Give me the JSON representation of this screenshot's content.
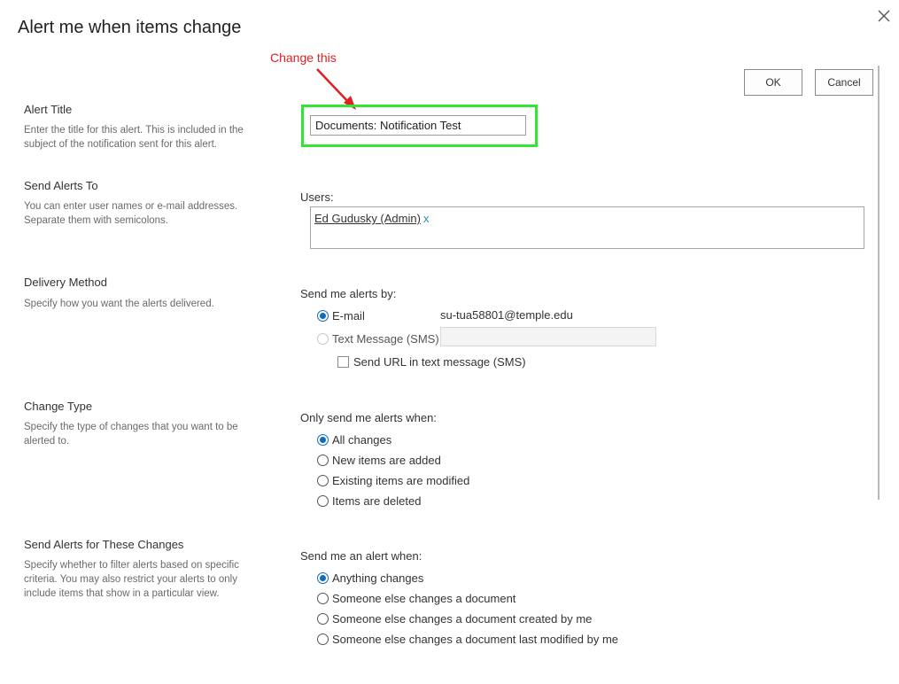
{
  "dialog": {
    "title": "Alert me when items change",
    "ok_label": "OK",
    "cancel_label": "Cancel"
  },
  "annotation": {
    "text": "Change this",
    "color": "#e02020",
    "highlight_color": "#33e533"
  },
  "sections": {
    "alert_title": {
      "title": "Alert Title",
      "description": "Enter the title for this alert. This is included in the subject of the notification sent for this alert.",
      "value": "Documents: Notification Test"
    },
    "send_to": {
      "title": "Send Alerts To",
      "description": "You can enter user names or e-mail addresses. Separate them with semicolons.",
      "users_label": "Users:",
      "user_name": "Ed Gudusky (Admin)",
      "remove_label": "x"
    },
    "delivery": {
      "title": "Delivery Method",
      "description": "Specify how you want the alerts delivered.",
      "label": "Send me alerts by:",
      "email_label": "E-mail",
      "email_value": "su-tua58801@temple.edu",
      "sms_label": "Text Message (SMS)",
      "send_url_label": "Send URL in text message (SMS)",
      "selected": "E-mail"
    },
    "change_type": {
      "title": "Change Type",
      "description": "Specify the type of changes that you want to be alerted to.",
      "label": "Only send me alerts when:",
      "options": [
        "All changes",
        "New items are added",
        "Existing items are modified",
        "Items are deleted"
      ],
      "selected": "All changes"
    },
    "filter": {
      "title": "Send Alerts for These Changes",
      "description": "Specify whether to filter alerts based on specific criteria. You may also restrict your alerts to only include items that show in a particular view.",
      "label": "Send me an alert when:",
      "options": [
        "Anything changes",
        "Someone else changes a document",
        "Someone else changes a document created by me",
        "Someone else changes a document last modified by me"
      ],
      "selected": "Anything changes"
    }
  }
}
